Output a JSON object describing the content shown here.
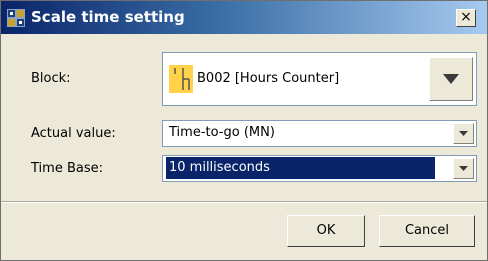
{
  "window": {
    "title": "Scale time setting",
    "close_label": "×"
  },
  "form": {
    "block_label": "Block:",
    "block_value": "B002 [Hours Counter]",
    "actual_value_label": "Actual value:",
    "actual_value": "Time-to-go (MN)",
    "time_base_label": "Time Base:",
    "time_base_value": "10 milliseconds"
  },
  "buttons": {
    "ok": "OK",
    "cancel": "Cancel"
  },
  "icons": {
    "app": "app-blocks-icon",
    "block": "hours-counter-block-icon",
    "close": "close-icon",
    "dropdown": "chevron-down-icon"
  },
  "colors": {
    "title_gradient_start": "#0a246a",
    "title_gradient_end": "#a6caf0",
    "selection": "#0a246a",
    "block_icon": "#ffd24a"
  }
}
